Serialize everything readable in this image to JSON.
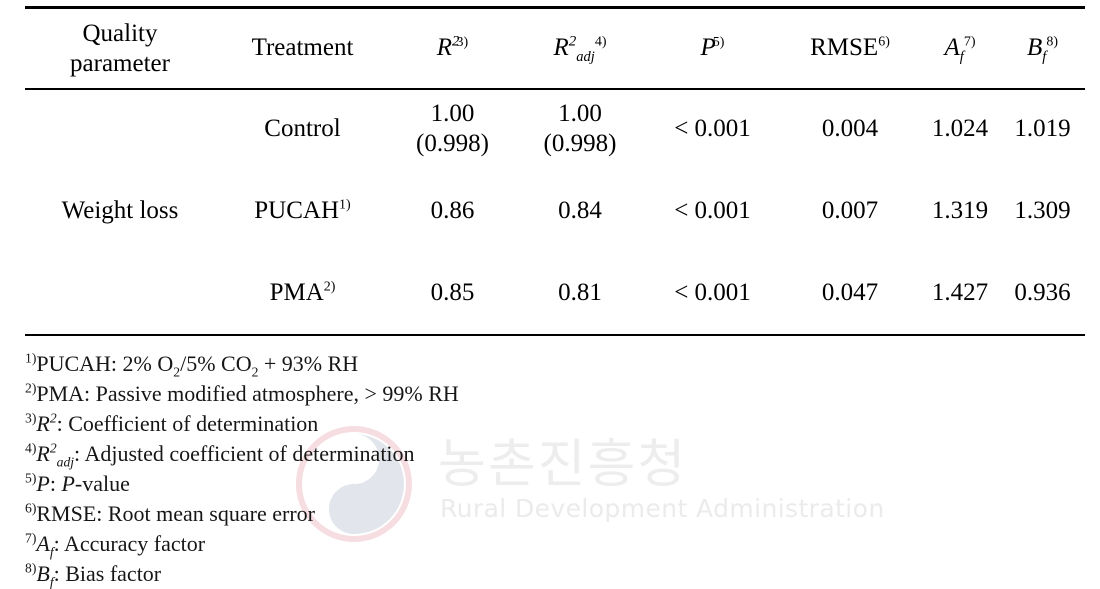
{
  "table": {
    "headers": {
      "quality_parameter_line1": "Quality",
      "quality_parameter_line2": "parameter",
      "treatment": "Treatment",
      "r2_symbol": "R",
      "r2_power": "2",
      "r2_footnote": "3)",
      "r2adj_symbol": "R",
      "r2adj_power": "2",
      "r2adj_sub": "adj",
      "r2adj_footnote": "4)",
      "p_symbol": "P",
      "p_footnote": "5)",
      "rmse_symbol": "RMSE",
      "rmse_footnote": "6)",
      "af_symbol": "A",
      "af_sub": "f",
      "af_footnote": "7)",
      "bf_symbol": "B",
      "bf_sub": "f",
      "bf_footnote": "8)"
    },
    "row_group_label": "Weight  loss",
    "rows": [
      {
        "treatment": "Control",
        "treatment_footnote": "",
        "r2": "1.00",
        "r2_paren": "(0.998)",
        "r2adj": "1.00",
        "r2adj_paren": "(0.998)",
        "p": "< 0.001",
        "rmse": "0.004",
        "af": "1.024",
        "bf": "1.019"
      },
      {
        "treatment": "PUCAH",
        "treatment_footnote": "1)",
        "r2": "0.86",
        "r2_paren": "",
        "r2adj": "0.84",
        "r2adj_paren": "",
        "p": "< 0.001",
        "rmse": "0.007",
        "af": "1.319",
        "bf": "1.309"
      },
      {
        "treatment": "PMA",
        "treatment_footnote": "2)",
        "r2": "0.85",
        "r2_paren": "",
        "r2adj": "0.81",
        "r2adj_paren": "",
        "p": "< 0.001",
        "rmse": "0.047",
        "af": "1.427",
        "bf": "0.936"
      }
    ]
  },
  "footnotes": {
    "n1": {
      "marker": "1)",
      "abbr": "PUCAH:",
      "text_a": "2% O",
      "sub_a": "2",
      "text_b": "/5% CO",
      "sub_b": "2",
      "text_c": " + 93% RH"
    },
    "n2": {
      "marker": "2)",
      "text": "PMA: Passive  modified  atmosphere, > 99% RH"
    },
    "n3": {
      "marker": "3)",
      "symbol": "R",
      "power": "2",
      "text": ": Coefficient  of  determination"
    },
    "n4": {
      "marker": "4)",
      "symbol": "R",
      "power": "2",
      "sub": "adj",
      "text": ": Adjusted  coefficient  of  determination"
    },
    "n5": {
      "marker": "5)",
      "symbol": "P",
      "text": ": ",
      "italic_tail": "P",
      "text_tail": "-value"
    },
    "n6": {
      "marker": "6)",
      "text": "RMSE: Root  mean  square  error"
    },
    "n7": {
      "marker": "7)",
      "symbol": "A",
      "sub": "f",
      "text": ": Accuracy  factor"
    },
    "n8": {
      "marker": "8)",
      "symbol": "B",
      "sub": "f",
      "text": ": Bias  factor"
    }
  },
  "watermark": {
    "korean": "농촌진흥청",
    "english": "Rural Development Administration",
    "logo_red": "#f2d8dc",
    "logo_blue": "#dfe3e9"
  }
}
